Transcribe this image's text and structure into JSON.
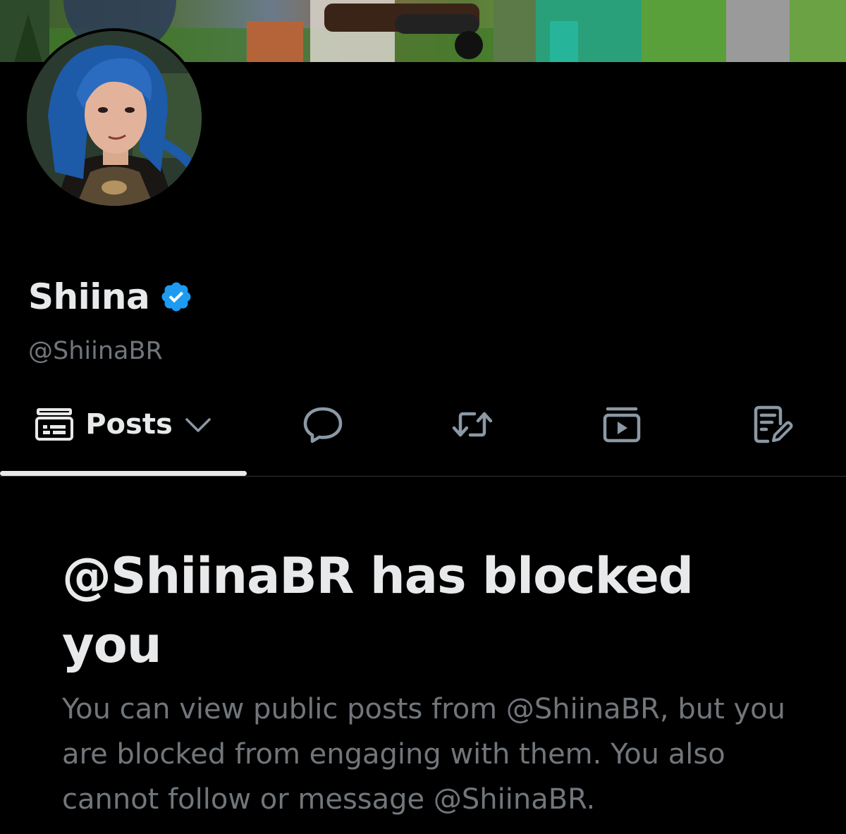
{
  "profile": {
    "display_name": "Shiina",
    "handle": "@ShiinaBR",
    "verified": true,
    "verified_color": "#1d9bf0"
  },
  "tabs": {
    "posts_label": "Posts",
    "posts_icon": "timeline-icon",
    "items": [
      {
        "name": "replies",
        "icon": "speech-bubble-icon"
      },
      {
        "name": "reposts",
        "icon": "repost-icon"
      },
      {
        "name": "media",
        "icon": "media-play-icon"
      },
      {
        "name": "articles",
        "icon": "article-edit-icon"
      }
    ],
    "active": "posts"
  },
  "blocked_notice": {
    "title": "@ShiinaBR has blocked you",
    "body": "You can view public posts from @ShiinaBR, but you are blocked from engaging with them. You also cannot follow or message @ShiinaBR."
  },
  "colors": {
    "background": "#000000",
    "primary_text": "#e7e9ea",
    "secondary_text": "#71767b",
    "divider": "#2f3336"
  }
}
